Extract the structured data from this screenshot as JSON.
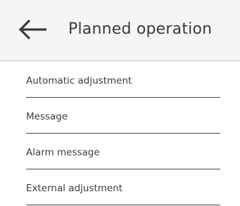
{
  "header": {
    "back_icon": "arrow-left-icon",
    "title": "Planned operation"
  },
  "menu": {
    "items": [
      {
        "label": "Automatic adjustment"
      },
      {
        "label": "Message"
      },
      {
        "label": "Alarm message"
      },
      {
        "label": "External adjustment"
      }
    ]
  },
  "colors": {
    "header_background": "#f5f5f5",
    "text": "#3c3c3c",
    "divider": "#4a4a4a"
  }
}
